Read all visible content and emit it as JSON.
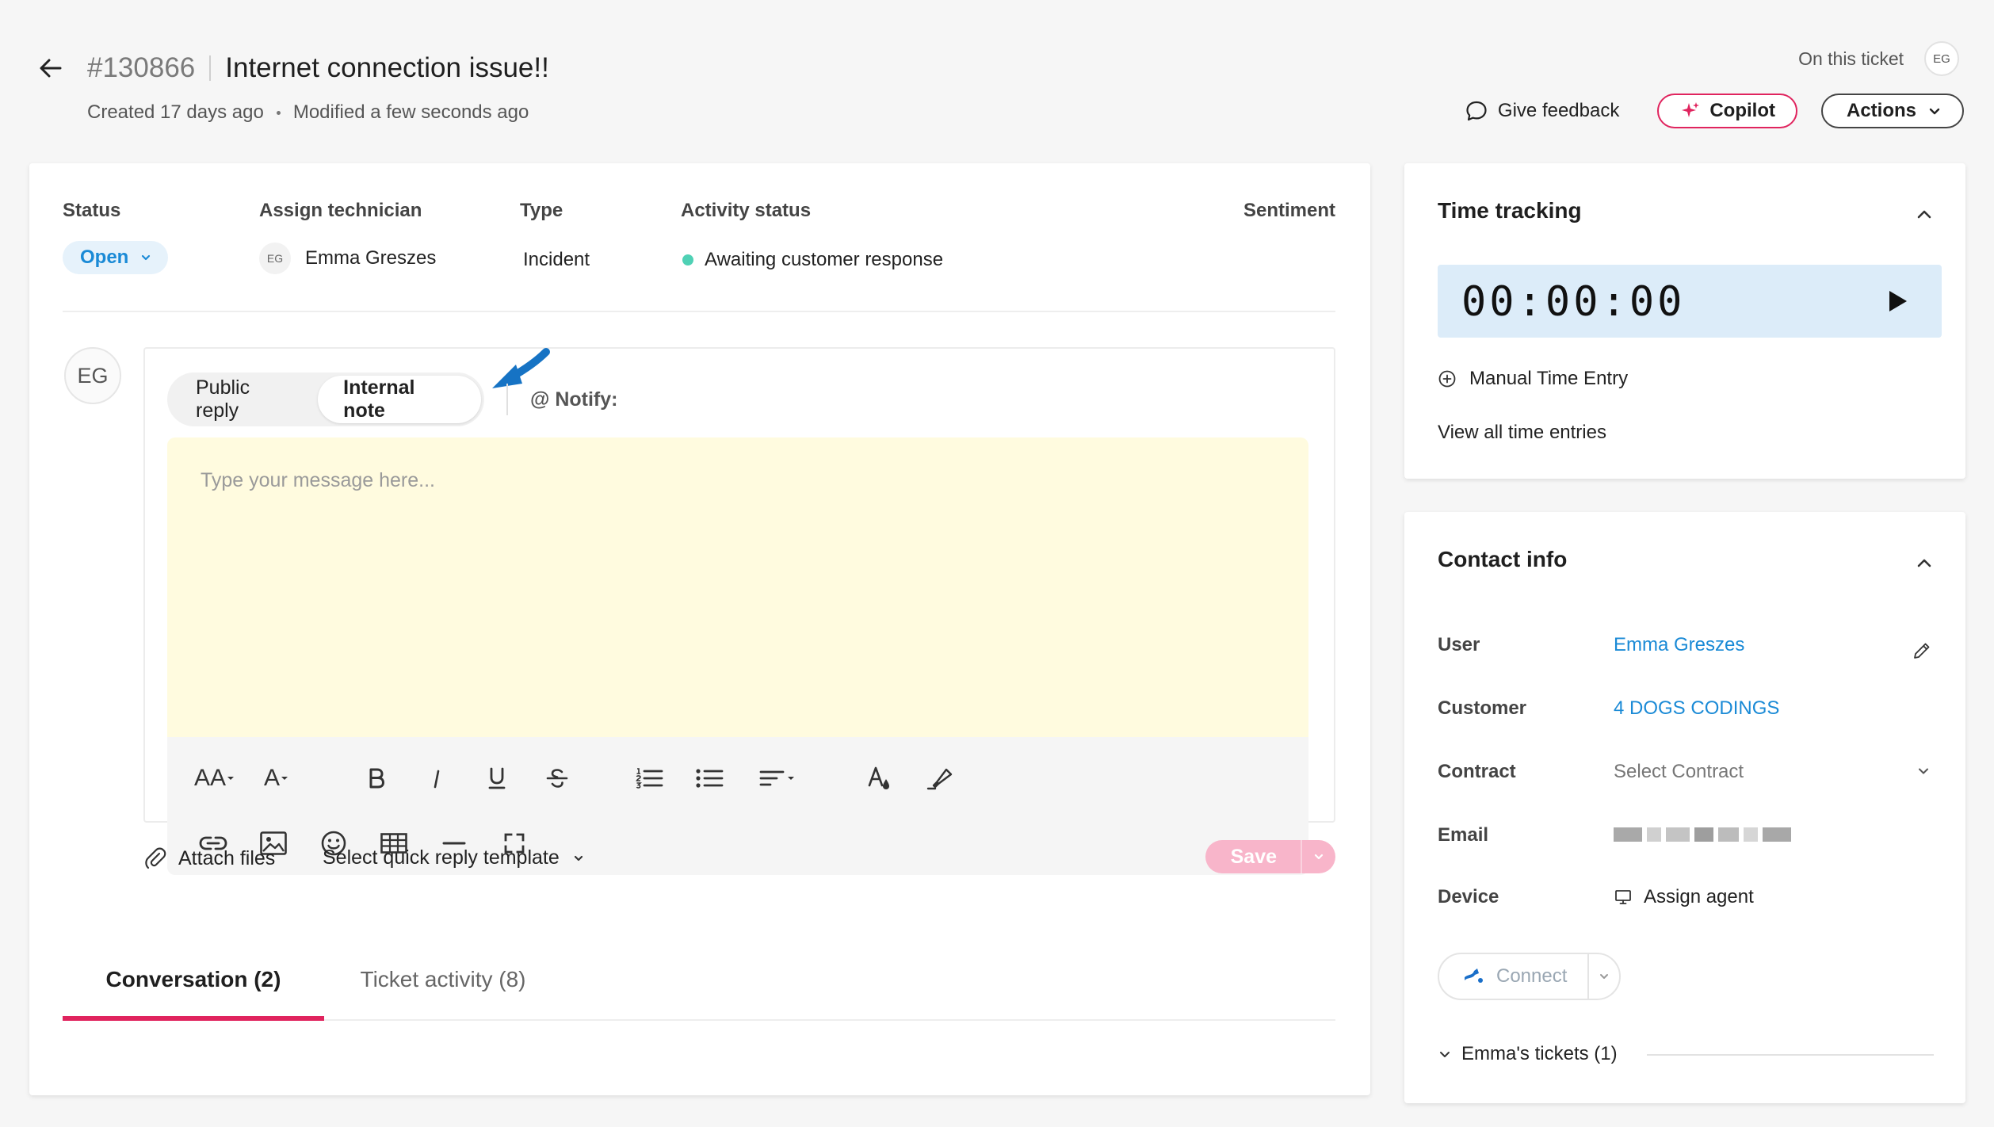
{
  "header": {
    "ticket_number": "#130866",
    "title": "Internet connection issue!!",
    "created": "Created 17 days ago",
    "modified": "Modified a few seconds ago",
    "on_this_ticket_label": "On this ticket",
    "on_this_ticket_avatar": "EG",
    "give_feedback": "Give feedback",
    "copilot": "Copilot",
    "actions": "Actions"
  },
  "fields": {
    "status_label": "Status",
    "status_value": "Open",
    "technician_label": "Assign technician",
    "technician_initials": "EG",
    "technician_name": "Emma Greszes",
    "type_label": "Type",
    "type_value": "Incident",
    "activity_label": "Activity status",
    "activity_value": "Awaiting customer response",
    "sentiment_label": "Sentiment"
  },
  "composer": {
    "avatar": "EG",
    "public_reply": "Public reply",
    "internal_note": "Internal note",
    "notify": "@ Notify:",
    "placeholder": "Type your message here...",
    "toolbar_font_size": "AA",
    "toolbar_font_color": "A",
    "attach_files": "Attach files",
    "quick_reply": "Select quick reply template",
    "save": "Save"
  },
  "tabs": {
    "conversation": "Conversation (2)",
    "ticket_activity": "Ticket activity (8)"
  },
  "time_tracking": {
    "title": "Time tracking",
    "timer": "00:00:00",
    "manual_entry": "Manual Time Entry",
    "view_all": "View all time entries"
  },
  "contact_info": {
    "title": "Contact info",
    "user_label": "User",
    "user_value": "Emma Greszes",
    "customer_label": "Customer",
    "customer_value": "4 DOGS CODINGS",
    "contract_label": "Contract",
    "contract_placeholder": "Select Contract",
    "email_label": "Email",
    "device_label": "Device",
    "device_value": "Assign agent",
    "connect": "Connect",
    "emma_tickets": "Emma's tickets (1)"
  },
  "colors": {
    "accent_pink": "#e0245e",
    "link_blue": "#1a8ad6",
    "note_yellow": "#fffbdf",
    "timer_blue": "#dcecf9",
    "activity_dot": "#4fd1b5"
  }
}
